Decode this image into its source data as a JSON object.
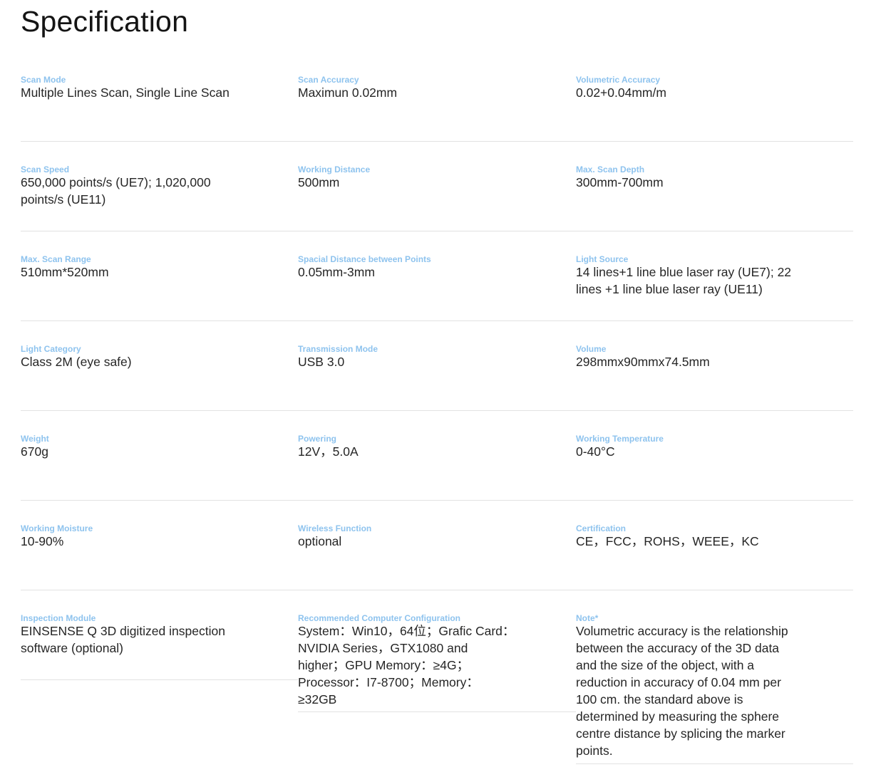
{
  "page_title": "Specification",
  "specs": [
    {
      "label": "Scan Mode",
      "value": "Multiple Lines Scan, Single Line Scan"
    },
    {
      "label": "Scan Accuracy",
      "value": "Maximun 0.02mm"
    },
    {
      "label": "Volumetric Accuracy",
      "value": "0.02+0.04mm/m"
    },
    {
      "label": "Scan Speed",
      "value": "650,000 points/s (UE7); 1,020,000\npoints/s (UE11)"
    },
    {
      "label": "Working Distance",
      "value": "500mm"
    },
    {
      "label": "Max. Scan Depth",
      "value": "300mm-700mm"
    },
    {
      "label": "Max. Scan Range",
      "value": "510mm*520mm"
    },
    {
      "label": "Spacial Distance between Points",
      "value": "0.05mm-3mm"
    },
    {
      "label": "Light Source",
      "value": "14 lines+1 line blue laser ray (UE7); 22\nlines +1 line blue laser ray (UE11)"
    },
    {
      "label": "Light Category",
      "value": "Class 2M (eye safe)"
    },
    {
      "label": "Transmission Mode",
      "value": "USB 3.0"
    },
    {
      "label": "Volume",
      "value": "298mmx90mmx74.5mm"
    },
    {
      "label": "Weight",
      "value": "670g"
    },
    {
      "label": "Powering",
      "value": "12V，5.0A"
    },
    {
      "label": "Working Temperature",
      "value": "0-40°C"
    },
    {
      "label": "Working Moisture",
      "value": "10-90%"
    },
    {
      "label": "Wireless Function",
      "value": "optional"
    },
    {
      "label": "Certification",
      "value": "CE，FCC，ROHS，WEEE，KC"
    },
    {
      "label": "Inspection Module",
      "value": "EINSENSE Q 3D digitized inspection\nsoftware (optional)"
    },
    {
      "label": "Recommended Computer Configuration",
      "value": "System：Win10，64位；Grafic Card：\nNVIDIA Series，GTX1080 and\nhigher；GPU Memory：≥4G；\nProcessor：I7-8700；Memory：\n≥32GB"
    },
    {
      "label": "Note*",
      "value": "Volumetric accuracy is the relationship\nbetween the accuracy of the 3D data\nand the size of the object, with a\nreduction in accuracy of 0.04 mm per\n100 cm. the standard above is\ndetermined by measuring the sphere\ncentre distance by splicing the marker\npoints."
    }
  ]
}
